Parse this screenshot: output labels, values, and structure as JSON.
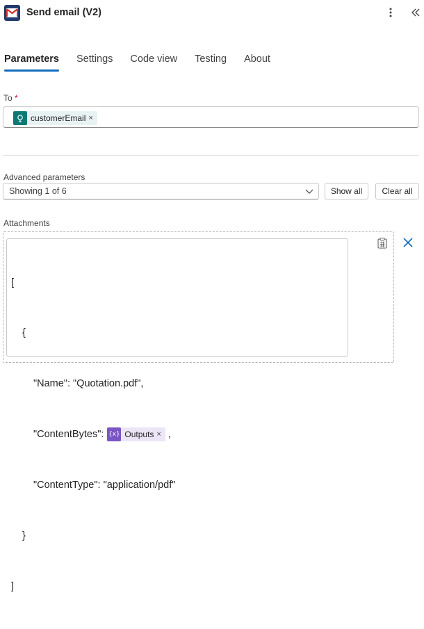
{
  "header": {
    "title": "Send email (V2)",
    "app_icon": "gmail-icon",
    "more_icon": "more-vertical-icon",
    "collapse_icon": "double-chevron-left-icon"
  },
  "tabs": [
    {
      "label": "Parameters",
      "active": true
    },
    {
      "label": "Settings",
      "active": false
    },
    {
      "label": "Code view",
      "active": false
    },
    {
      "label": "Testing",
      "active": false
    },
    {
      "label": "About",
      "active": false
    }
  ],
  "to_field": {
    "label": "To",
    "required_marker": "*",
    "token": {
      "label": "customerEmail",
      "icon": "dynamic-content-icon",
      "remove": "×"
    }
  },
  "advanced": {
    "label": "Advanced parameters",
    "selected": "Showing 1 of 6",
    "show_all_label": "Show all",
    "clear_all_label": "Clear all"
  },
  "attachments": {
    "label": "Attachments",
    "lines": {
      "open_bracket": "[",
      "open_brace": "{",
      "name_line": "\"Name\": \"Quotation.pdf\",",
      "content_bytes_key": "\"ContentBytes\":",
      "content_bytes_token": "Outputs",
      "content_bytes_token_remove": "×",
      "content_bytes_trailer": ",",
      "content_type_line": "\"ContentType\": \"application/pdf\"",
      "close_brace": "}",
      "close_bracket": "]"
    },
    "expression_icon_glyph": "{x}",
    "clip_icon": "clipboard-icon",
    "close_icon": "close-icon"
  },
  "colors": {
    "accent": "#0f6cbd",
    "required": "#c50f1f",
    "token_teal": "#0b7a75",
    "token_purple": "#7a55c4"
  }
}
